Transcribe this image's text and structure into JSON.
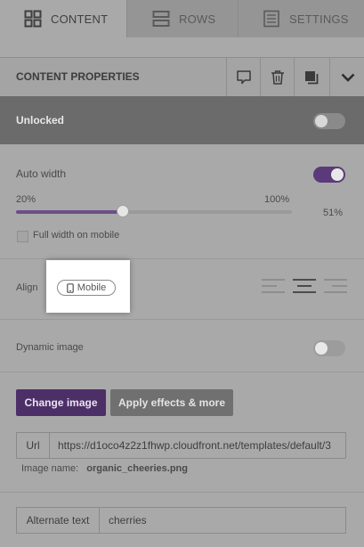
{
  "tabs": {
    "content": "CONTENT",
    "rows": "ROWS",
    "settings": "SETTINGS"
  },
  "header": {
    "title": "CONTENT PROPERTIES",
    "icons": [
      "comment-icon",
      "trash-icon",
      "duplicate-icon",
      "chevron-down-icon"
    ]
  },
  "lock": {
    "label": "Unlocked",
    "enabled": false
  },
  "width": {
    "auto_label": "Auto width",
    "auto_enabled": true,
    "min_label": "20%",
    "max_label": "100%",
    "value_label": "51%",
    "value_percent": 51,
    "full_mobile_label": "Full width on mobile",
    "full_mobile_checked": false
  },
  "align": {
    "label": "Align",
    "mobile_pill": "Mobile",
    "selected": "center"
  },
  "dynamic": {
    "label": "Dynamic image",
    "enabled": false
  },
  "image": {
    "change_button": "Change image",
    "effects_button": "Apply effects & more",
    "url_label": "Url",
    "url_value": "https://d1oco4z2z1fhwp.cloudfront.net/templates/default/3",
    "name_label": "Image name:",
    "name_value": "organic_cheeries.png"
  },
  "alt": {
    "label": "Alternate text",
    "value": "cherries"
  },
  "colors": {
    "accent": "#5b3a7a",
    "primary_button": "#4d2f68",
    "lock_band": "#6b6b6b"
  }
}
